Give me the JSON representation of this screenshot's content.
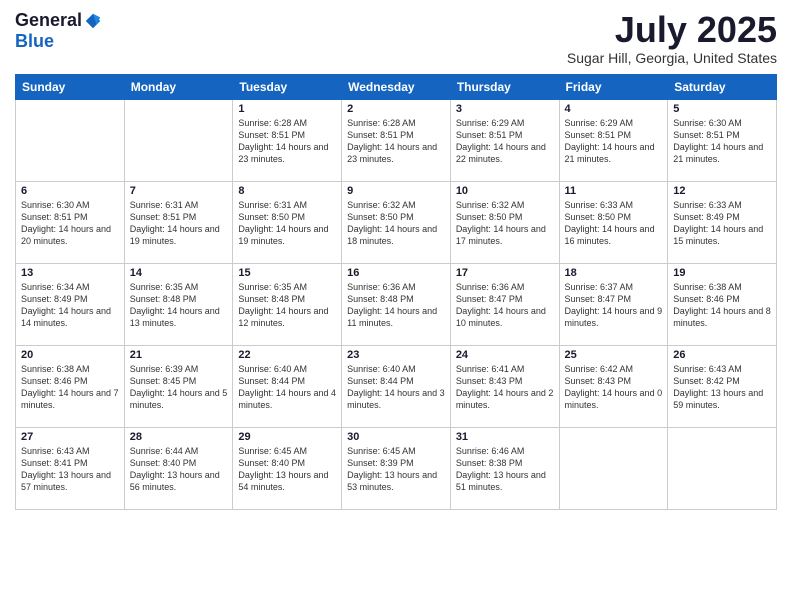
{
  "logo": {
    "general": "General",
    "blue": "Blue"
  },
  "title": "July 2025",
  "location": "Sugar Hill, Georgia, United States",
  "days_of_week": [
    "Sunday",
    "Monday",
    "Tuesday",
    "Wednesday",
    "Thursday",
    "Friday",
    "Saturday"
  ],
  "weeks": [
    [
      {
        "day": "",
        "info": ""
      },
      {
        "day": "",
        "info": ""
      },
      {
        "day": "1",
        "info": "Sunrise: 6:28 AM\nSunset: 8:51 PM\nDaylight: 14 hours and 23 minutes."
      },
      {
        "day": "2",
        "info": "Sunrise: 6:28 AM\nSunset: 8:51 PM\nDaylight: 14 hours and 23 minutes."
      },
      {
        "day": "3",
        "info": "Sunrise: 6:29 AM\nSunset: 8:51 PM\nDaylight: 14 hours and 22 minutes."
      },
      {
        "day": "4",
        "info": "Sunrise: 6:29 AM\nSunset: 8:51 PM\nDaylight: 14 hours and 21 minutes."
      },
      {
        "day": "5",
        "info": "Sunrise: 6:30 AM\nSunset: 8:51 PM\nDaylight: 14 hours and 21 minutes."
      }
    ],
    [
      {
        "day": "6",
        "info": "Sunrise: 6:30 AM\nSunset: 8:51 PM\nDaylight: 14 hours and 20 minutes."
      },
      {
        "day": "7",
        "info": "Sunrise: 6:31 AM\nSunset: 8:51 PM\nDaylight: 14 hours and 19 minutes."
      },
      {
        "day": "8",
        "info": "Sunrise: 6:31 AM\nSunset: 8:50 PM\nDaylight: 14 hours and 19 minutes."
      },
      {
        "day": "9",
        "info": "Sunrise: 6:32 AM\nSunset: 8:50 PM\nDaylight: 14 hours and 18 minutes."
      },
      {
        "day": "10",
        "info": "Sunrise: 6:32 AM\nSunset: 8:50 PM\nDaylight: 14 hours and 17 minutes."
      },
      {
        "day": "11",
        "info": "Sunrise: 6:33 AM\nSunset: 8:50 PM\nDaylight: 14 hours and 16 minutes."
      },
      {
        "day": "12",
        "info": "Sunrise: 6:33 AM\nSunset: 8:49 PM\nDaylight: 14 hours and 15 minutes."
      }
    ],
    [
      {
        "day": "13",
        "info": "Sunrise: 6:34 AM\nSunset: 8:49 PM\nDaylight: 14 hours and 14 minutes."
      },
      {
        "day": "14",
        "info": "Sunrise: 6:35 AM\nSunset: 8:48 PM\nDaylight: 14 hours and 13 minutes."
      },
      {
        "day": "15",
        "info": "Sunrise: 6:35 AM\nSunset: 8:48 PM\nDaylight: 14 hours and 12 minutes."
      },
      {
        "day": "16",
        "info": "Sunrise: 6:36 AM\nSunset: 8:48 PM\nDaylight: 14 hours and 11 minutes."
      },
      {
        "day": "17",
        "info": "Sunrise: 6:36 AM\nSunset: 8:47 PM\nDaylight: 14 hours and 10 minutes."
      },
      {
        "day": "18",
        "info": "Sunrise: 6:37 AM\nSunset: 8:47 PM\nDaylight: 14 hours and 9 minutes."
      },
      {
        "day": "19",
        "info": "Sunrise: 6:38 AM\nSunset: 8:46 PM\nDaylight: 14 hours and 8 minutes."
      }
    ],
    [
      {
        "day": "20",
        "info": "Sunrise: 6:38 AM\nSunset: 8:46 PM\nDaylight: 14 hours and 7 minutes."
      },
      {
        "day": "21",
        "info": "Sunrise: 6:39 AM\nSunset: 8:45 PM\nDaylight: 14 hours and 5 minutes."
      },
      {
        "day": "22",
        "info": "Sunrise: 6:40 AM\nSunset: 8:44 PM\nDaylight: 14 hours and 4 minutes."
      },
      {
        "day": "23",
        "info": "Sunrise: 6:40 AM\nSunset: 8:44 PM\nDaylight: 14 hours and 3 minutes."
      },
      {
        "day": "24",
        "info": "Sunrise: 6:41 AM\nSunset: 8:43 PM\nDaylight: 14 hours and 2 minutes."
      },
      {
        "day": "25",
        "info": "Sunrise: 6:42 AM\nSunset: 8:43 PM\nDaylight: 14 hours and 0 minutes."
      },
      {
        "day": "26",
        "info": "Sunrise: 6:43 AM\nSunset: 8:42 PM\nDaylight: 13 hours and 59 minutes."
      }
    ],
    [
      {
        "day": "27",
        "info": "Sunrise: 6:43 AM\nSunset: 8:41 PM\nDaylight: 13 hours and 57 minutes."
      },
      {
        "day": "28",
        "info": "Sunrise: 6:44 AM\nSunset: 8:40 PM\nDaylight: 13 hours and 56 minutes."
      },
      {
        "day": "29",
        "info": "Sunrise: 6:45 AM\nSunset: 8:40 PM\nDaylight: 13 hours and 54 minutes."
      },
      {
        "day": "30",
        "info": "Sunrise: 6:45 AM\nSunset: 8:39 PM\nDaylight: 13 hours and 53 minutes."
      },
      {
        "day": "31",
        "info": "Sunrise: 6:46 AM\nSunset: 8:38 PM\nDaylight: 13 hours and 51 minutes."
      },
      {
        "day": "",
        "info": ""
      },
      {
        "day": "",
        "info": ""
      }
    ]
  ]
}
